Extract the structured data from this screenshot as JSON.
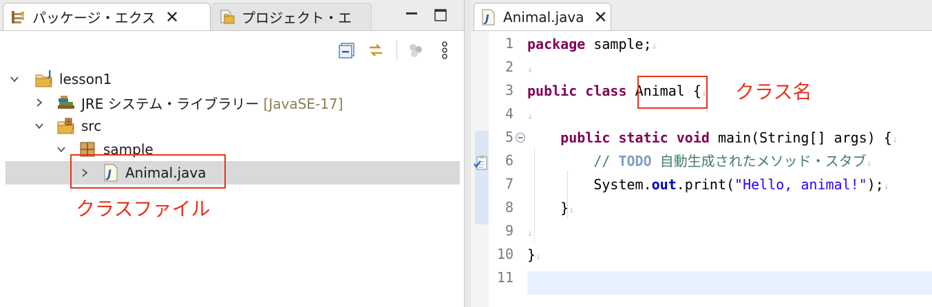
{
  "left_pane": {
    "tabs": [
      {
        "label": "パッケージ・エクス",
        "icon": "package-explorer-icon",
        "active": true
      },
      {
        "label": "プロジェクト・エ",
        "icon": "project-explorer-icon",
        "active": false
      }
    ],
    "tree": [
      {
        "label": "lesson1",
        "icon": "java-project-icon",
        "expanded": true
      },
      {
        "label": "JRE システム・ライブラリー",
        "decoration": "[JavaSE-17]",
        "icon": "library-icon",
        "expanded": false
      },
      {
        "label": "src",
        "icon": "source-folder-icon",
        "expanded": true
      },
      {
        "label": "sample",
        "icon": "package-icon",
        "expanded": true
      },
      {
        "label": "Animal.java",
        "icon": "java-file-icon",
        "expanded": false,
        "selected": true
      }
    ],
    "annotation": "クラスファイル"
  },
  "editor": {
    "tab_label": "Animal.java",
    "line_numbers": [
      "1",
      "2",
      "3",
      "4",
      "5",
      "6",
      "7",
      "8",
      "9",
      "10",
      "11"
    ],
    "annotation": "クラス名",
    "code": {
      "l1_kw": "package",
      "l1_rest": " sample;",
      "l3_kw1": "public",
      "l3_kw2": "class",
      "l3_name": "Animal",
      "l3_brace": " {",
      "l5_kw1": "public",
      "l5_kw2": "static",
      "l5_kw3": "void",
      "l5_rest": " main(String[] args) {",
      "l6_cm1": "// ",
      "l6_todo": "TODO",
      "l6_cm2": " 自動生成されたメソッド・スタブ",
      "l7_a": "System.",
      "l7_fld": "out",
      "l7_b": ".print(",
      "l7_str": "\"Hello, animal!\"",
      "l7_c": ");",
      "l8": "}",
      "l10": "}"
    },
    "whitespace_glyph": "↓"
  },
  "colors": {
    "keyword": "#7f0055",
    "comment": "#3f7f5f",
    "string": "#2a00ff",
    "annotation_red": "#e8321e",
    "current_line": "#e8f2fe"
  }
}
